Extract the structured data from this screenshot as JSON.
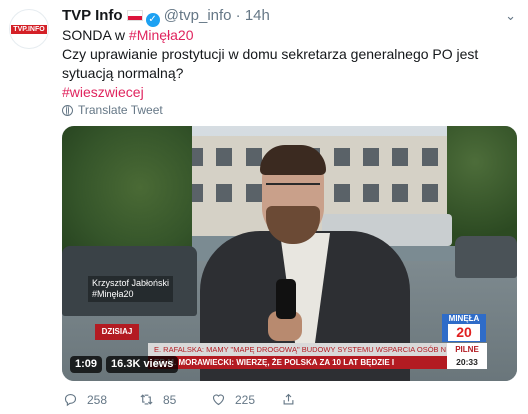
{
  "tweet": {
    "author_name": "TVP Info",
    "handle": "@tvp_info",
    "separator": "·",
    "time": "14h",
    "avatar_text": "TVP.INFO",
    "text_line1_prefix": "SONDA w ",
    "text_line1_hashtag": "#Minęła20",
    "text_body": "Czy uprawianie prostytucji w domu sekretarza generalnego PO jest sytuacją normalną?",
    "hashtag2": "#wieszwiecej",
    "translate_label": "Translate Tweet"
  },
  "video": {
    "caption_name": "Krzysztof Jabłoński",
    "caption_tag": "#Minęła20",
    "today_label": "DZISIAJ",
    "ticker_top": "E. RAFALSKA: MAMY \"MAPĘ DROGOWĄ\" BUDOWY SYSTEMU WSPARCIA OSÓB N",
    "ticker_bottom": "ER M. MORAWIECKI: WIERZĘ, ŻE POLSKA ZA 10 LAT BĘDZIE I",
    "pilne_label": "PILNE",
    "clock": "20:33",
    "brand_top": "MINĘŁA",
    "brand_num": "20",
    "duration": "1:09",
    "views": "16.3K views"
  },
  "actions": {
    "replies": "258",
    "retweets": "85",
    "likes": "225"
  },
  "colors": {
    "accent": "#1da1f2",
    "hashtag": "#e0245e",
    "tvp_red": "#b31b22"
  }
}
